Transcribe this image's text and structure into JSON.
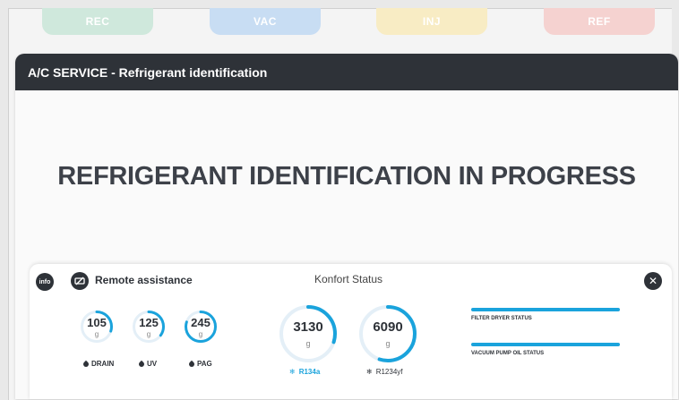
{
  "tabs": [
    {
      "label": "REC",
      "color": "#cfe8dc"
    },
    {
      "label": "VAC",
      "color": "#c8ddf3"
    },
    {
      "label": "INJ",
      "color": "#f8ecc4"
    },
    {
      "label": "REF",
      "color": "#f5d2d0"
    }
  ],
  "panel": {
    "title": "A/C SERVICE - Refrigerant identification",
    "status": "REFRIGERANT IDENTIFICATION IN PROGRESS"
  },
  "bottom": {
    "info_label": "info",
    "remote_assistance": "Remote assistance",
    "konfort_status": "Konfort Status",
    "oil_gauges": [
      {
        "value": "105",
        "unit": "g",
        "label": "DRAIN",
        "fill": 0.3
      },
      {
        "value": "125",
        "unit": "g",
        "label": "UV",
        "fill": 0.35
      },
      {
        "value": "245",
        "unit": "g",
        "label": "PAG",
        "fill": 0.8
      }
    ],
    "gas_gauges": [
      {
        "value": "3130",
        "unit": "g",
        "label": "R134a",
        "fill": 0.3,
        "active": true
      },
      {
        "value": "6090",
        "unit": "g",
        "label": "R1234yf",
        "fill": 0.55,
        "active": false
      }
    ],
    "filter_dryer_status": "FILTER DRYER STATUS",
    "vacuum_pump_status": "VACUUM PUMP OIL STATUS"
  },
  "colors": {
    "accent": "#1aa3dc",
    "dark": "#2e3238",
    "gauge_track": "#e4eff7"
  }
}
